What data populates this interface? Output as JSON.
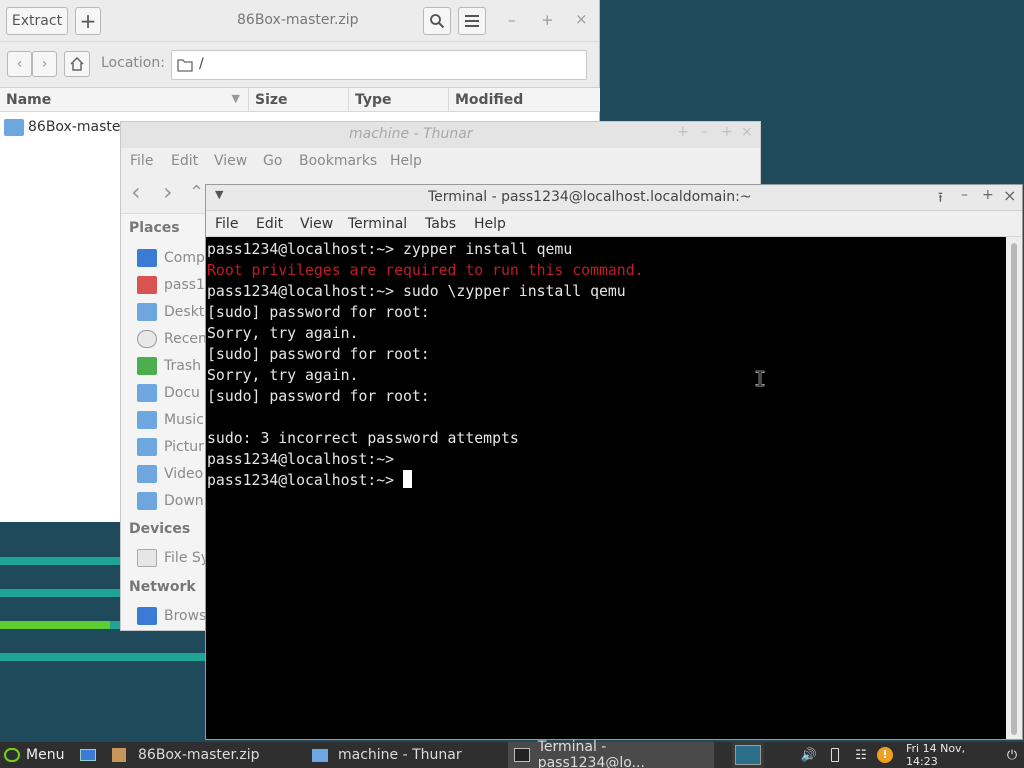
{
  "archive": {
    "toolbar": {
      "extract_label": "Extract",
      "add_label": "+"
    },
    "title": "86Box-master.zip",
    "window_controls": {
      "minimize": "–",
      "maximize": "+",
      "close": "×"
    },
    "location_label": "Location:",
    "location_value": "/",
    "columns": [
      "Name",
      "Size",
      "Type",
      "Modified"
    ],
    "rows": [
      {
        "name": "86Box-master"
      }
    ]
  },
  "thunar": {
    "title": "machine - Thunar",
    "menu": [
      "File",
      "Edit",
      "View",
      "Go",
      "Bookmarks",
      "Help"
    ],
    "places_header": "Places",
    "places": [
      "Comp",
      "pass1",
      "Deskto",
      "Recen",
      "Trash",
      "Docu",
      "Music",
      "Pictur",
      "Video",
      "Down"
    ],
    "devices_header": "Devices",
    "devices": [
      "File Sy"
    ],
    "network_header": "Network",
    "network": [
      "Brows"
    ]
  },
  "terminal": {
    "title": "Terminal - pass1234@localhost.localdomain:~",
    "menu": [
      "File",
      "Edit",
      "View",
      "Terminal",
      "Tabs",
      "Help"
    ],
    "lines": [
      "pass1234@localhost:~> zypper install qemu",
      "Root privileges are required to run this command.",
      "pass1234@localhost:~> sudo \\zypper install qemu",
      "[sudo] password for root:",
      "Sorry, try again.",
      "[sudo] password for root:",
      "Sorry, try again.",
      "[sudo] password for root:",
      "",
      "sudo: 3 incorrect password attempts",
      "pass1234@localhost:~>",
      "pass1234@localhost:~> "
    ],
    "colors": {
      "error": "#c01c28",
      "text": "#e6e6e6",
      "background": "#000000"
    }
  },
  "taskbar": {
    "menu_label": "Menu",
    "tasks": [
      "86Box-master.zip",
      "machine - Thunar",
      "Terminal - pass1234@lo..."
    ],
    "clock": "Fri 14 Nov, 14:23"
  },
  "colors": {
    "desktop": "#1e4a5c",
    "accent_green": "#73d216",
    "stripe_teal": "#1ea89a"
  }
}
